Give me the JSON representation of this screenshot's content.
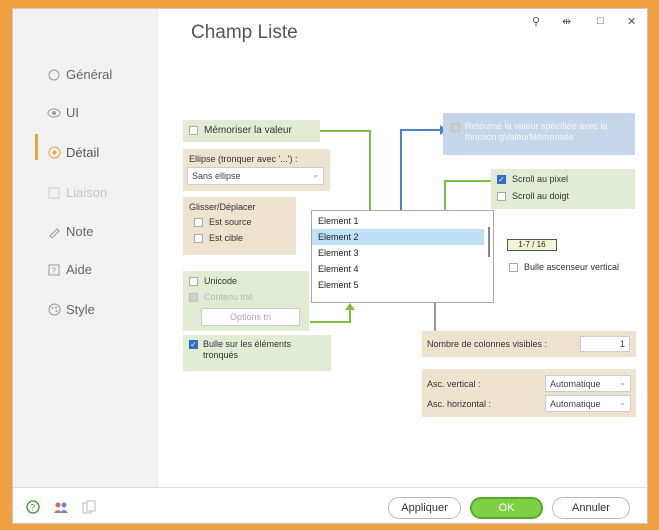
{
  "window": {
    "title": "Champ Liste",
    "controls": [
      "⚲",
      "⇹",
      "□",
      "✕"
    ]
  },
  "nav": {
    "items": [
      {
        "label": "Général",
        "icon": "circle-icon"
      },
      {
        "label": "UI",
        "icon": "eye-icon"
      },
      {
        "label": "Détail",
        "icon": "detail-icon"
      },
      {
        "label": "Liaison",
        "icon": "link-icon"
      },
      {
        "label": "Note",
        "icon": "note-icon"
      },
      {
        "label": "Aide",
        "icon": "help-icon"
      },
      {
        "label": "Style",
        "icon": "style-icon"
      }
    ],
    "active": "Détail"
  },
  "detail": {
    "memoriser": {
      "label": "Mémoriser la valeur",
      "checked": false
    },
    "retourne": {
      "label": "Retourne la valeur spécifiée avec la fonction gValeurMémorisée",
      "checked": false,
      "disabled": true
    },
    "ellipse": {
      "label": "Ellipse (tronquer avec '...') :",
      "value": "Sans ellipse"
    },
    "glisser": {
      "label": "Glisser/Déplacer",
      "source": "Est source",
      "cible": "Est cible"
    },
    "list": {
      "items": [
        "Element 1",
        "Element 2",
        "Element 3",
        "Element 4",
        "Element 5"
      ],
      "selected_index": 1
    },
    "scroll_pixel": {
      "label": "Scroll au pixel",
      "checked": true
    },
    "scroll_doigt": {
      "label": "Scroll au doigt",
      "checked": false
    },
    "counter": "1-7 / 16",
    "bulle_asc": {
      "label": "Bulle ascenseur vertical",
      "checked": false
    },
    "unicode": {
      "label": "Unicode",
      "checked": false
    },
    "contenu_trie": {
      "label": "Contenu trié",
      "checked": false,
      "disabled": true
    },
    "options_tri": "Options tri",
    "bulle_elements": {
      "label": "Bulle sur les éléments tronqués",
      "checked": true
    },
    "nb_colonnes": {
      "label": "Nombre de colonnes visibles :",
      "value": "1"
    },
    "asc_vertical": {
      "label": "Asc. vertical :",
      "value": "Automatique"
    },
    "asc_horizontal": {
      "label": "Asc. horizontal :",
      "value": "Automatique"
    }
  },
  "footer": {
    "appliquer": "Appliquer",
    "ok": "OK",
    "annuler": "Annuler"
  },
  "colors": {
    "accent": "#f0a040",
    "ok_green": "#7fd044",
    "arrow_green": "#7fbf3f",
    "arrow_blue": "#4a86c5",
    "selection": "#bfe0f7"
  }
}
